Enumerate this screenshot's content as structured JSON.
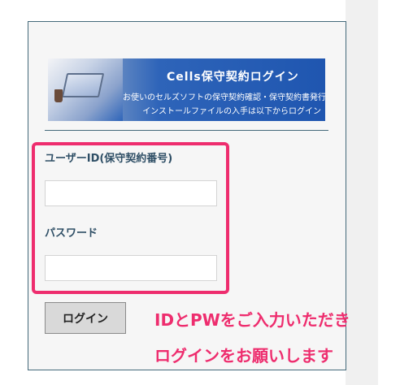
{
  "banner": {
    "title": "Cells保守契約ログイン",
    "line1": "お使いのセルズソフトの保守契約確認・保守契約書発行",
    "line2": "インストールファイルの入手は以下からログイン"
  },
  "form": {
    "userid_label": "ユーザーID(保守契約番号)",
    "userid_value": "",
    "password_label": "パスワード",
    "password_value": "",
    "login_button": "ログイン"
  },
  "annotation": {
    "line1": "IDとPWをご入力いただき",
    "line2": "ログインをお願いします"
  },
  "colors": {
    "highlight": "#ee2d6e",
    "label": "#2f4f66",
    "panel_border": "#44697a",
    "banner_blue": "#1f56b0"
  }
}
